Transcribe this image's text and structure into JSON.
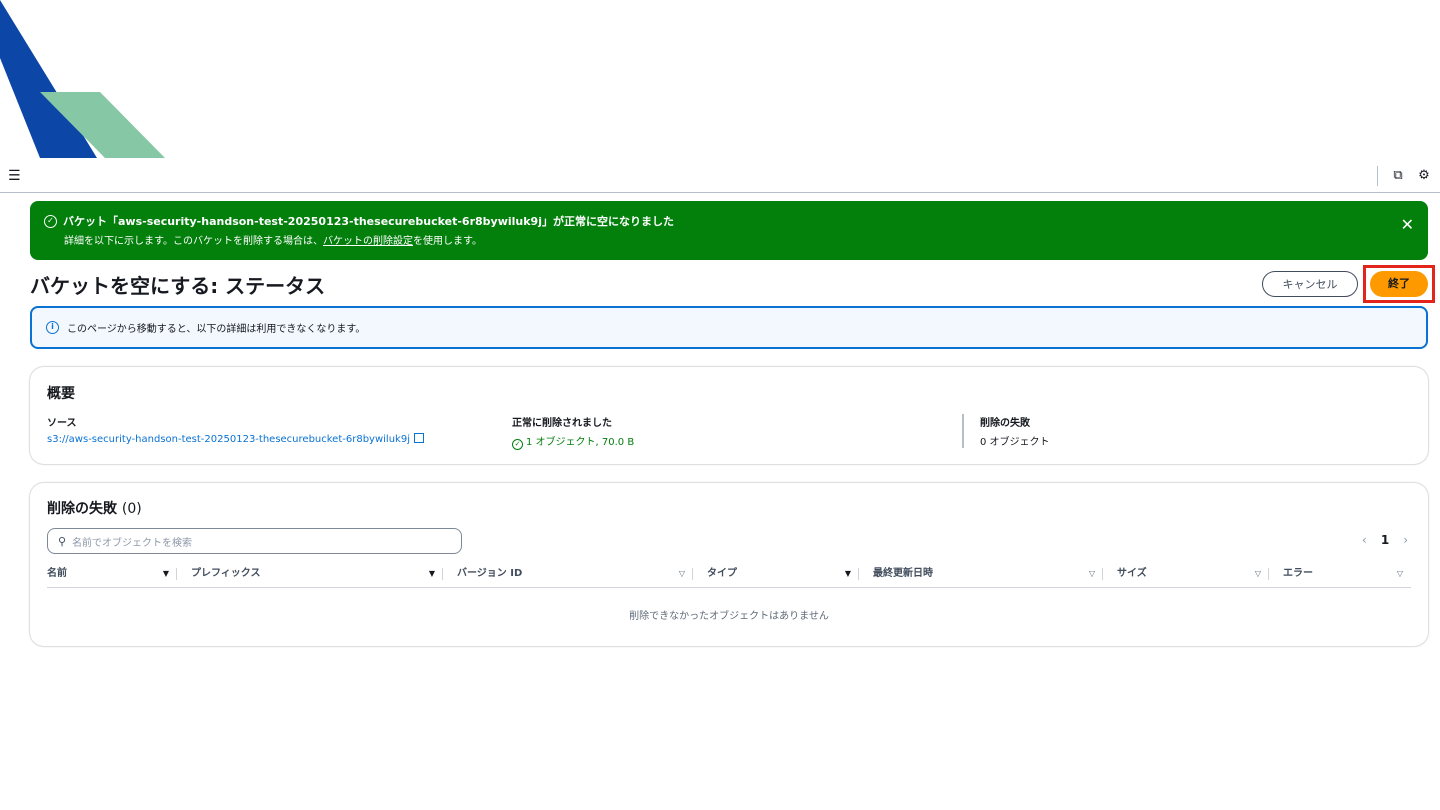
{
  "topbar": {
    "menu_icon": "hamburger-icon",
    "right_icons": [
      "copy-icon",
      "settings-icon"
    ]
  },
  "flash": {
    "title": "バケット「aws-security-handson-test-20250123-thesecurebucket-6r8bywiluk9j」が正常に空になりました",
    "desc_prefix": "詳細を以下に示します。このバケットを削除する場合は、",
    "desc_link": "バケットの削除設定",
    "desc_suffix": "を使用します。",
    "color": "#037f0c"
  },
  "header": {
    "title": "バケットを空にする: ステータス",
    "cancel_label": "キャンセル",
    "done_label": "終了"
  },
  "info": {
    "message": "このページから移動すると、以下の詳細は利用できなくなります。"
  },
  "summary": {
    "title": "概要",
    "source_label": "ソース",
    "source_value": "s3://aws-security-handson-test-20250123-thesecurebucket-6r8bywiluk9j",
    "succeeded_label": "正常に削除されました",
    "succeeded_value": "1 オブジェクト, 70.0 B",
    "failed_label": "削除の失敗",
    "failed_value": "0 オブジェクト"
  },
  "failures": {
    "title": "削除の失敗",
    "count": "(0)",
    "search_placeholder": "名前でオブジェクトを検索",
    "page": "1",
    "columns": [
      "名前",
      "プレフィックス",
      "バージョン ID",
      "タイプ",
      "最終更新日時",
      "サイズ",
      "エラー"
    ],
    "empty_message": "削除できなかったオブジェクトはありません"
  }
}
